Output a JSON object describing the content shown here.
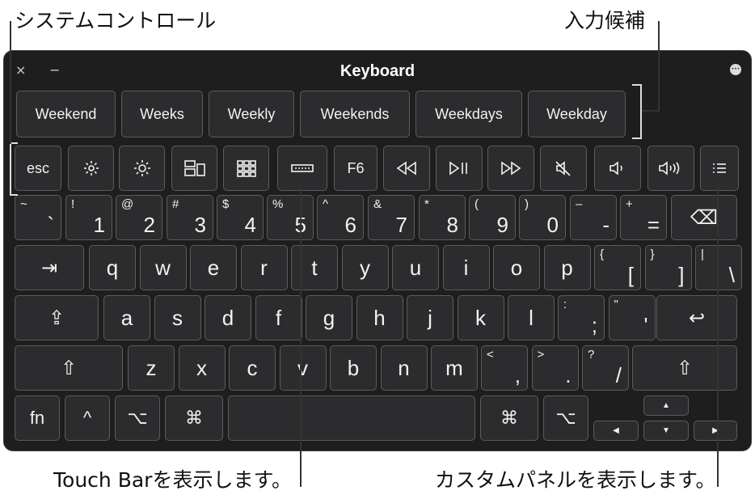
{
  "callouts": {
    "system_controls": "システムコントロール",
    "input_suggestions": "入力候補",
    "show_touch_bar": "Touch Barを表示します。",
    "show_custom_panel": "カスタムパネルを表示します。"
  },
  "window": {
    "title": "Keyboard",
    "close": "×",
    "minimize": "−",
    "menu": "•••"
  },
  "suggestions": [
    "Weekend",
    "Weeks",
    "Weekly",
    "Weekends",
    "Weekdays",
    "Weekday"
  ],
  "function_row": {
    "esc": "esc",
    "f6": "F6",
    "icons": [
      "brightness-down-icon",
      "brightness-up-icon",
      "mission-control-icon",
      "launchpad-icon",
      "touch-bar-icon",
      "rewind-icon",
      "play-pause-icon",
      "fast-forward-icon",
      "mute-icon",
      "volume-down-icon",
      "volume-up-icon",
      "custom-panel-icon"
    ]
  },
  "number_row": [
    {
      "small": "~",
      "main": "`"
    },
    {
      "small": "!",
      "main": "1"
    },
    {
      "small": "@",
      "main": "2"
    },
    {
      "small": "#",
      "main": "3"
    },
    {
      "small": "$",
      "main": "4"
    },
    {
      "small": "%",
      "main": "5"
    },
    {
      "small": "^",
      "main": "6"
    },
    {
      "small": "&",
      "main": "7"
    },
    {
      "small": "*",
      "main": "8"
    },
    {
      "small": "(",
      "main": "9"
    },
    {
      "small": ")",
      "main": "0"
    },
    {
      "small": "–",
      "main": "-"
    },
    {
      "small": "+",
      "main": "="
    }
  ],
  "row_q": [
    "q",
    "w",
    "e",
    "r",
    "t",
    "y",
    "u",
    "i",
    "o",
    "p"
  ],
  "row_q_brackets": [
    {
      "small": "{",
      "main": "["
    },
    {
      "small": "}",
      "main": "]"
    },
    {
      "small": "|",
      "main": "\\"
    }
  ],
  "row_a": [
    "a",
    "s",
    "d",
    "f",
    "g",
    "h",
    "j",
    "k",
    "l"
  ],
  "row_a_punct": [
    {
      "small": ":",
      "main": ";"
    },
    {
      "small": "\"",
      "main": "'"
    }
  ],
  "row_z": [
    "z",
    "x",
    "c",
    "v",
    "b",
    "n",
    "m"
  ],
  "row_z_punct": [
    {
      "small": "<",
      "main": ","
    },
    {
      "small": ">",
      "main": "."
    },
    {
      "small": "?",
      "main": "/"
    }
  ],
  "bottom": {
    "fn": "fn",
    "ctrl": "^",
    "option": "⌥",
    "command": "⌘"
  },
  "symbols": {
    "tab": "⇥",
    "capslock": "⇪",
    "shift": "⇧",
    "return": "↩",
    "delete": "⌫",
    "up": "▲",
    "down": "▼",
    "left": "◀",
    "right": "▶"
  }
}
